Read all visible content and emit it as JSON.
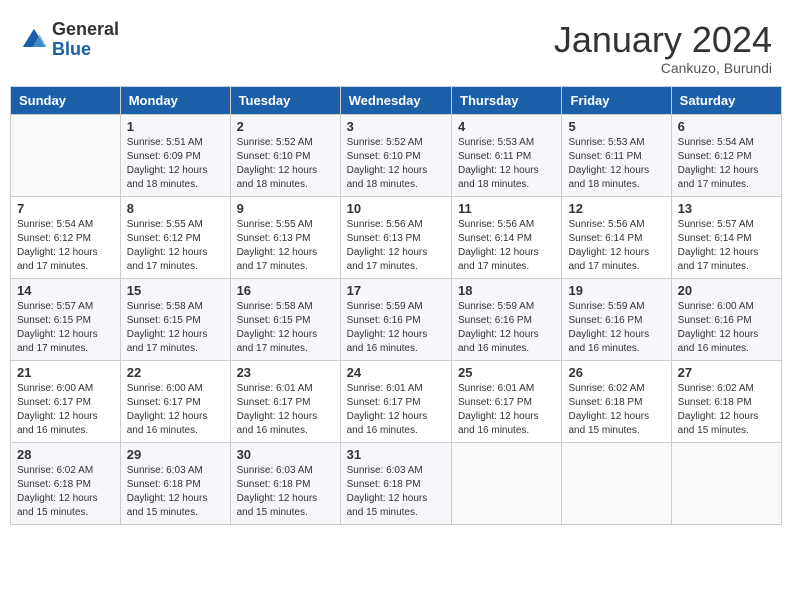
{
  "header": {
    "logo_general": "General",
    "logo_blue": "Blue",
    "month": "January 2024",
    "location": "Cankuzo, Burundi"
  },
  "days_of_week": [
    "Sunday",
    "Monday",
    "Tuesday",
    "Wednesday",
    "Thursday",
    "Friday",
    "Saturday"
  ],
  "weeks": [
    [
      {
        "day": "",
        "sunrise": "",
        "sunset": "",
        "daylight": ""
      },
      {
        "day": "1",
        "sunrise": "Sunrise: 5:51 AM",
        "sunset": "Sunset: 6:09 PM",
        "daylight": "Daylight: 12 hours and 18 minutes."
      },
      {
        "day": "2",
        "sunrise": "Sunrise: 5:52 AM",
        "sunset": "Sunset: 6:10 PM",
        "daylight": "Daylight: 12 hours and 18 minutes."
      },
      {
        "day": "3",
        "sunrise": "Sunrise: 5:52 AM",
        "sunset": "Sunset: 6:10 PM",
        "daylight": "Daylight: 12 hours and 18 minutes."
      },
      {
        "day": "4",
        "sunrise": "Sunrise: 5:53 AM",
        "sunset": "Sunset: 6:11 PM",
        "daylight": "Daylight: 12 hours and 18 minutes."
      },
      {
        "day": "5",
        "sunrise": "Sunrise: 5:53 AM",
        "sunset": "Sunset: 6:11 PM",
        "daylight": "Daylight: 12 hours and 18 minutes."
      },
      {
        "day": "6",
        "sunrise": "Sunrise: 5:54 AM",
        "sunset": "Sunset: 6:12 PM",
        "daylight": "Daylight: 12 hours and 17 minutes."
      }
    ],
    [
      {
        "day": "7",
        "sunrise": "Sunrise: 5:54 AM",
        "sunset": "Sunset: 6:12 PM",
        "daylight": "Daylight: 12 hours and 17 minutes."
      },
      {
        "day": "8",
        "sunrise": "Sunrise: 5:55 AM",
        "sunset": "Sunset: 6:12 PM",
        "daylight": "Daylight: 12 hours and 17 minutes."
      },
      {
        "day": "9",
        "sunrise": "Sunrise: 5:55 AM",
        "sunset": "Sunset: 6:13 PM",
        "daylight": "Daylight: 12 hours and 17 minutes."
      },
      {
        "day": "10",
        "sunrise": "Sunrise: 5:56 AM",
        "sunset": "Sunset: 6:13 PM",
        "daylight": "Daylight: 12 hours and 17 minutes."
      },
      {
        "day": "11",
        "sunrise": "Sunrise: 5:56 AM",
        "sunset": "Sunset: 6:14 PM",
        "daylight": "Daylight: 12 hours and 17 minutes."
      },
      {
        "day": "12",
        "sunrise": "Sunrise: 5:56 AM",
        "sunset": "Sunset: 6:14 PM",
        "daylight": "Daylight: 12 hours and 17 minutes."
      },
      {
        "day": "13",
        "sunrise": "Sunrise: 5:57 AM",
        "sunset": "Sunset: 6:14 PM",
        "daylight": "Daylight: 12 hours and 17 minutes."
      }
    ],
    [
      {
        "day": "14",
        "sunrise": "Sunrise: 5:57 AM",
        "sunset": "Sunset: 6:15 PM",
        "daylight": "Daylight: 12 hours and 17 minutes."
      },
      {
        "day": "15",
        "sunrise": "Sunrise: 5:58 AM",
        "sunset": "Sunset: 6:15 PM",
        "daylight": "Daylight: 12 hours and 17 minutes."
      },
      {
        "day": "16",
        "sunrise": "Sunrise: 5:58 AM",
        "sunset": "Sunset: 6:15 PM",
        "daylight": "Daylight: 12 hours and 17 minutes."
      },
      {
        "day": "17",
        "sunrise": "Sunrise: 5:59 AM",
        "sunset": "Sunset: 6:16 PM",
        "daylight": "Daylight: 12 hours and 16 minutes."
      },
      {
        "day": "18",
        "sunrise": "Sunrise: 5:59 AM",
        "sunset": "Sunset: 6:16 PM",
        "daylight": "Daylight: 12 hours and 16 minutes."
      },
      {
        "day": "19",
        "sunrise": "Sunrise: 5:59 AM",
        "sunset": "Sunset: 6:16 PM",
        "daylight": "Daylight: 12 hours and 16 minutes."
      },
      {
        "day": "20",
        "sunrise": "Sunrise: 6:00 AM",
        "sunset": "Sunset: 6:16 PM",
        "daylight": "Daylight: 12 hours and 16 minutes."
      }
    ],
    [
      {
        "day": "21",
        "sunrise": "Sunrise: 6:00 AM",
        "sunset": "Sunset: 6:17 PM",
        "daylight": "Daylight: 12 hours and 16 minutes."
      },
      {
        "day": "22",
        "sunrise": "Sunrise: 6:00 AM",
        "sunset": "Sunset: 6:17 PM",
        "daylight": "Daylight: 12 hours and 16 minutes."
      },
      {
        "day": "23",
        "sunrise": "Sunrise: 6:01 AM",
        "sunset": "Sunset: 6:17 PM",
        "daylight": "Daylight: 12 hours and 16 minutes."
      },
      {
        "day": "24",
        "sunrise": "Sunrise: 6:01 AM",
        "sunset": "Sunset: 6:17 PM",
        "daylight": "Daylight: 12 hours and 16 minutes."
      },
      {
        "day": "25",
        "sunrise": "Sunrise: 6:01 AM",
        "sunset": "Sunset: 6:17 PM",
        "daylight": "Daylight: 12 hours and 16 minutes."
      },
      {
        "day": "26",
        "sunrise": "Sunrise: 6:02 AM",
        "sunset": "Sunset: 6:18 PM",
        "daylight": "Daylight: 12 hours and 15 minutes."
      },
      {
        "day": "27",
        "sunrise": "Sunrise: 6:02 AM",
        "sunset": "Sunset: 6:18 PM",
        "daylight": "Daylight: 12 hours and 15 minutes."
      }
    ],
    [
      {
        "day": "28",
        "sunrise": "Sunrise: 6:02 AM",
        "sunset": "Sunset: 6:18 PM",
        "daylight": "Daylight: 12 hours and 15 minutes."
      },
      {
        "day": "29",
        "sunrise": "Sunrise: 6:03 AM",
        "sunset": "Sunset: 6:18 PM",
        "daylight": "Daylight: 12 hours and 15 minutes."
      },
      {
        "day": "30",
        "sunrise": "Sunrise: 6:03 AM",
        "sunset": "Sunset: 6:18 PM",
        "daylight": "Daylight: 12 hours and 15 minutes."
      },
      {
        "day": "31",
        "sunrise": "Sunrise: 6:03 AM",
        "sunset": "Sunset: 6:18 PM",
        "daylight": "Daylight: 12 hours and 15 minutes."
      },
      {
        "day": "",
        "sunrise": "",
        "sunset": "",
        "daylight": ""
      },
      {
        "day": "",
        "sunrise": "",
        "sunset": "",
        "daylight": ""
      },
      {
        "day": "",
        "sunrise": "",
        "sunset": "",
        "daylight": ""
      }
    ]
  ]
}
